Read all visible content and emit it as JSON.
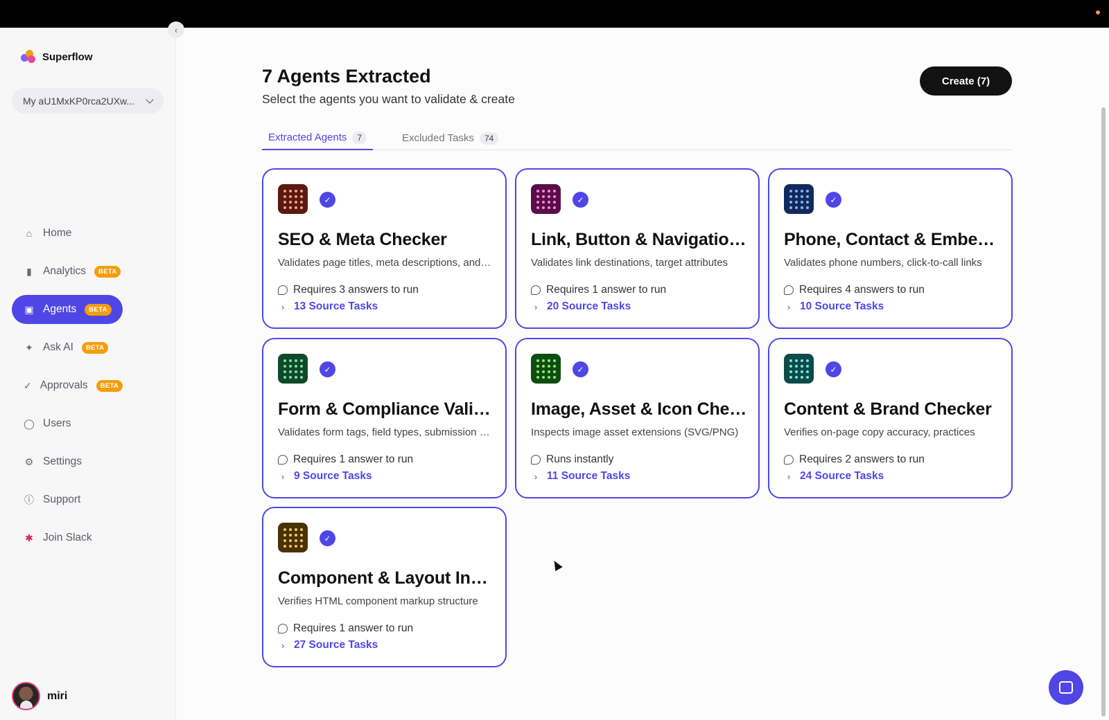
{
  "app": {
    "name": "Superflow"
  },
  "workspace": {
    "label": "My aU1MxKP0rca2UXw..."
  },
  "nav": [
    {
      "label": "Home",
      "icon": "home-icon",
      "badge": ""
    },
    {
      "label": "Analytics",
      "icon": "bar-chart-icon",
      "badge": "BETA"
    },
    {
      "label": "Agents",
      "icon": "agent-icon",
      "badge": "BETA",
      "active": true
    },
    {
      "label": "Ask AI",
      "icon": "sparkle-icon",
      "badge": "BETA"
    },
    {
      "label": "Approvals",
      "icon": "check-icon",
      "badge": "BETA"
    },
    {
      "label": "Users",
      "icon": "user-icon",
      "badge": ""
    },
    {
      "label": "Settings",
      "icon": "gear-icon",
      "badge": ""
    },
    {
      "label": "Support",
      "icon": "info-icon",
      "badge": ""
    },
    {
      "label": "Join Slack",
      "icon": "slack-icon",
      "badge": ""
    }
  ],
  "user": {
    "name": "miri"
  },
  "header": {
    "title": "7 Agents Extracted",
    "subtitle": "Select the agents you want to validate & create",
    "create_label": "Create (7)"
  },
  "tabs": [
    {
      "label": "Extracted Agents",
      "count": "7",
      "active": true
    },
    {
      "label": "Excluded Tasks",
      "count": "74",
      "active": false
    }
  ],
  "agents": [
    {
      "title": "SEO & Meta Checker",
      "description": "Validates page titles, meta descriptions, and SEO tags",
      "requirement": "Requires 3 answers to run",
      "source_tasks": "13 Source Tasks",
      "icon_bg": "#5a1a10",
      "dot_color": "#f2a38a"
    },
    {
      "title": "Link, Button & Navigation Checker",
      "description": "Validates link destinations, target attributes",
      "requirement": "Requires 1 answer to run",
      "source_tasks": "20 Source Tasks",
      "icon_bg": "#5b0d4a",
      "dot_color": "#f38bd8"
    },
    {
      "title": "Phone, Contact & Embed Checker",
      "description": "Validates phone numbers, click-to-call links",
      "requirement": "Requires 4 answers to run",
      "source_tasks": "10 Source Tasks",
      "icon_bg": "#102a5c",
      "dot_color": "#8fb2f5"
    },
    {
      "title": "Form & Compliance Validator",
      "description": "Validates form tags, field types, submission handling",
      "requirement": "Requires 1 answer to run",
      "source_tasks": "9 Source Tasks",
      "icon_bg": "#0e4a2a",
      "dot_color": "#7fe0a8"
    },
    {
      "title": "Image, Asset & Icon Checker",
      "description": "Inspects image asset extensions (SVG/PNG)",
      "requirement": "Runs instantly",
      "source_tasks": "11 Source Tasks",
      "icon_bg": "#0f4d0f",
      "dot_color": "#8cea7c"
    },
    {
      "title": "Content & Brand Checker",
      "description": "Verifies on-page copy accuracy, practices",
      "requirement": "Requires 2 answers to run",
      "source_tasks": "24 Source Tasks",
      "icon_bg": "#0e4a4a",
      "dot_color": "#7ce6df"
    },
    {
      "title": "Component & Layout Inspector",
      "description": "Verifies HTML component markup structure",
      "requirement": "Requires 1 answer to run",
      "source_tasks": "27 Source Tasks",
      "icon_bg": "#4a3206",
      "dot_color": "#f1c766"
    }
  ],
  "colors": {
    "accent": "#4f46e5",
    "beta_badge": "#f59e0b"
  }
}
